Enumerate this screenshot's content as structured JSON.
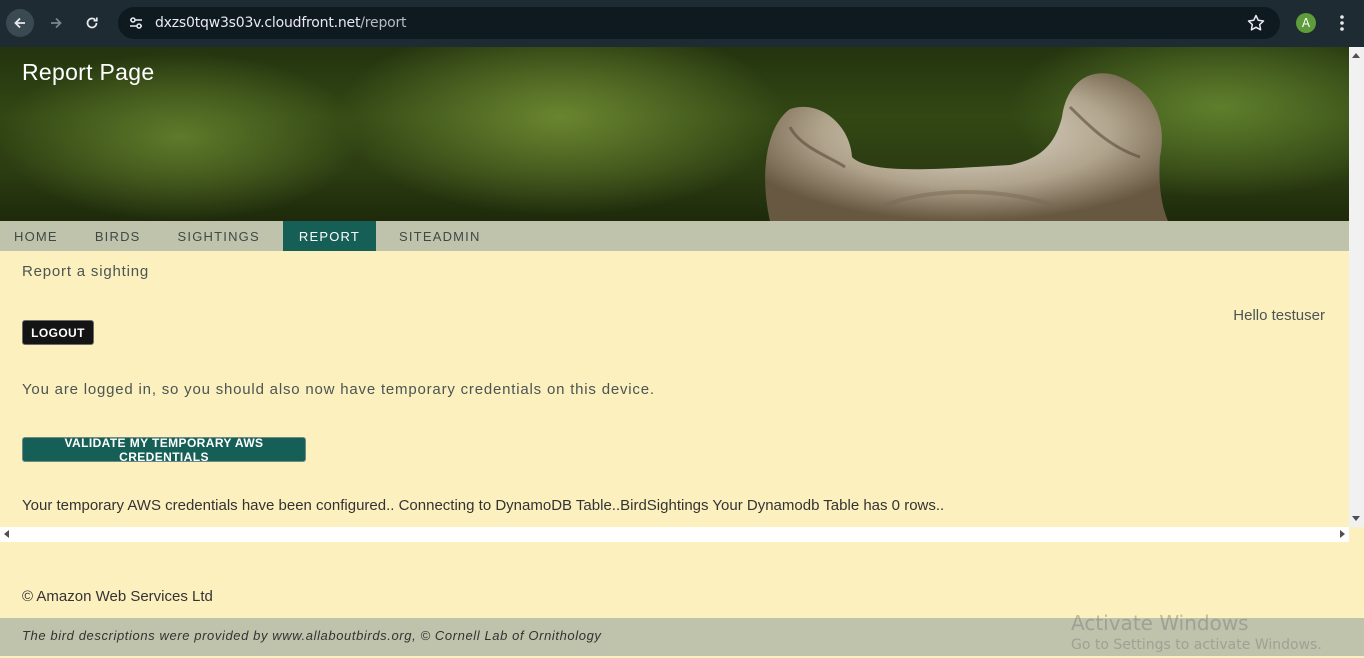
{
  "browser": {
    "url_host": "dxzs0tqw3s03v.cloudfront.net",
    "url_path": "/report",
    "profile_initial": "A",
    "icons": [
      "back-arrow-icon",
      "forward-arrow-icon",
      "reload-icon",
      "site-settings-icon",
      "bookmark-star-icon",
      "kebab-menu-icon"
    ]
  },
  "header": {
    "title": "Report Page"
  },
  "nav": {
    "items": [
      {
        "label": "HOME"
      },
      {
        "label": "BIRDS"
      },
      {
        "label": "SIGHTINGS"
      },
      {
        "label": "REPORT",
        "active": true
      },
      {
        "label": "SITEADMIN"
      }
    ]
  },
  "main": {
    "subtitle": "Report a sighting",
    "greeting": "Hello testuser",
    "logout_label": "LOGOUT",
    "status_message": "You are logged in, so you should also now have temporary credentials on this device.",
    "validate_label": "VALIDATE MY TEMPORARY AWS CREDENTIALS",
    "result_message": "Your temporary AWS credentials have been configured.. Connecting to DynamoDB Table..BirdSightings Your Dynamodb Table has 0 rows.."
  },
  "footer": {
    "copyright": "© Amazon Web Services Ltd",
    "credits": "The bird descriptions were provided by www.allaboutbirds.org, © Cornell Lab of Ornithology"
  },
  "watermark": {
    "title": "Activate Windows",
    "subtitle": "Go to Settings to activate Windows."
  },
  "colors": {
    "accent": "#165f56",
    "nav_bg": "#bfc3ab",
    "page_bg": "#fdf0bf",
    "chrome_bg": "#1e2b33"
  }
}
